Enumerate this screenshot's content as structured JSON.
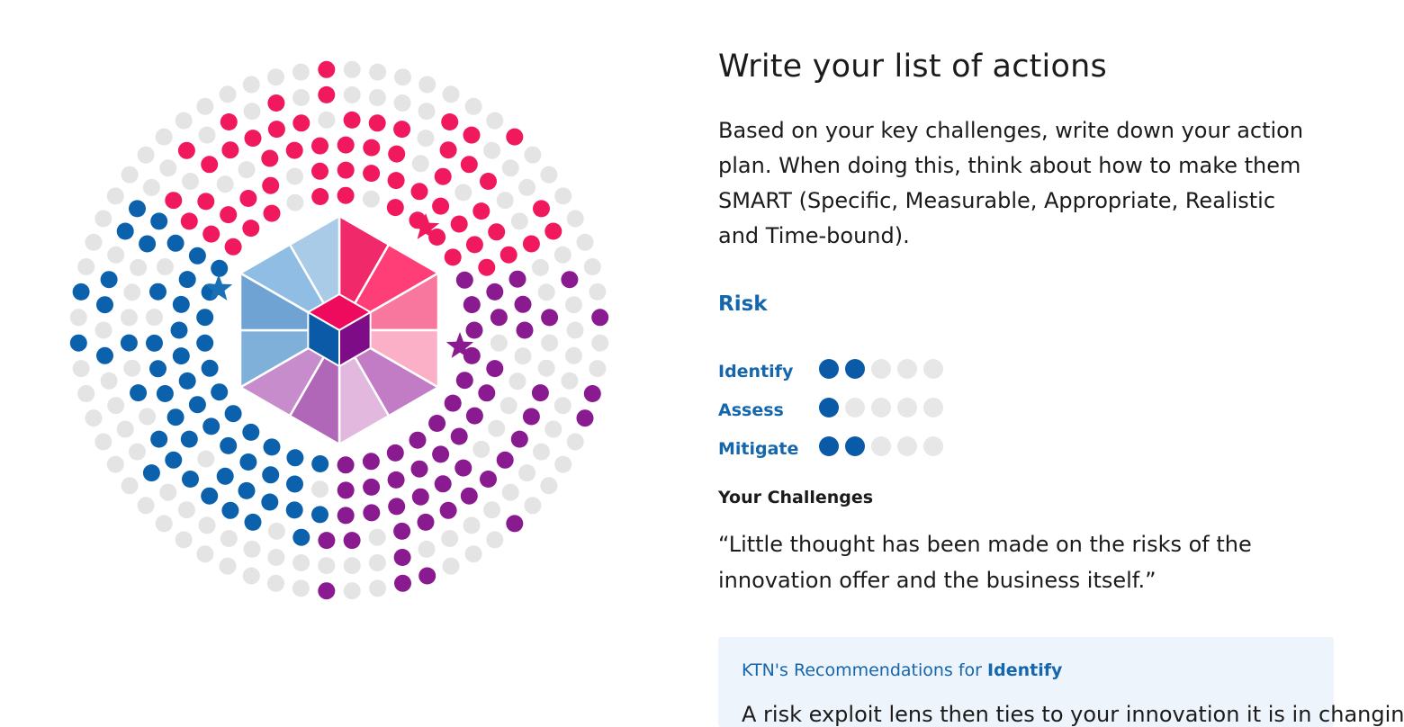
{
  "page": {
    "title": "Write your list of actions",
    "intro": "Based on your key challenges, write down your action plan. When doing this, think about how to make them SMART (Specific, Measurable, Appropriate, Realistic and Time-bound)."
  },
  "risk": {
    "heading": "Risk",
    "rows": [
      {
        "label": "Identify",
        "filled": 2,
        "total": 5
      },
      {
        "label": "Assess",
        "filled": 1,
        "total": 5
      },
      {
        "label": "Mitigate",
        "filled": 2,
        "total": 5
      }
    ]
  },
  "challenges": {
    "heading": "Your Challenges",
    "quote": "“Little thought has been made on the risks of the innovation offer and the business itself.”"
  },
  "recommendations": {
    "prefix": "KTN's Recommendations for ",
    "topic": "Identify",
    "body_cut": "A risk exploit lens then ties to your innovation it is in changing"
  },
  "colors": {
    "pink": "#f0195e",
    "purple": "#8a1a8f",
    "blue": "#0b61ac",
    "grey": "#e4e4e4",
    "accent_text": "#1466ad"
  },
  "visual": {
    "icons": [
      "pink-star-icon",
      "blue-star-icon",
      "purple-star-icon"
    ],
    "segments": [
      "pink",
      "blue",
      "purple"
    ]
  }
}
